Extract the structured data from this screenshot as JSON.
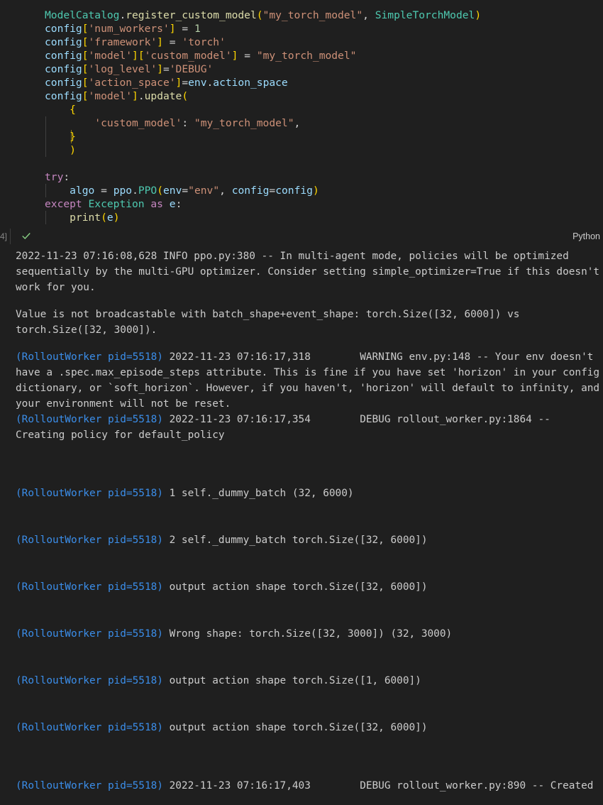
{
  "cell": {
    "execution_count": "4]",
    "language": "Python",
    "status": "success",
    "code_lines": [
      "ModelCatalog.register_custom_model(\"my_torch_model\", SimpleTorchModel)",
      "config['num_workers'] = 1",
      "config['framework'] = 'torch'",
      "config['model']['custom_model'] = \"my_torch_model\"",
      "config['log_level']='DEBUG'",
      "config['action_space']=env.action_space",
      "config['model'].update(",
      "    {",
      "        'custom_model': \"my_torch_model\",",
      "    }",
      "    )",
      "",
      "try:",
      "    algo = ppo.PPO(env=\"env\", config=config)",
      "except Exception as e:",
      "    print(e)"
    ]
  },
  "output": {
    "info_msg": "2022-11-23 07:16:08,628 INFO ppo.py:380 -- In multi-agent mode, policies will be optimized sequentially by the multi-GPU optimizer. Consider setting simple_optimizer=True if this doesn't work for you.",
    "error_msg": "Value is not broadcastable with batch_shape+event_shape: torch.Size([32, 6000]) vs torch.Size([32, 3000]).",
    "warning_prefix": "(RolloutWorker pid=5518)",
    "warning_msg": " 2022-11-23 07:16:17,318\tWARNING env.py:148 -- Your env doesn't have a .spec.max_episode_steps attribute. This is fine if you have set 'horizon' in your config dictionary, or `soft_horizon`. However, if you haven't, 'horizon' will default to infinity, and your environment will not be reset.",
    "debug_prefix": "(RolloutWorker pid=5518)",
    "debug_msg": " 2022-11-23 07:16:17,354\tDEBUG rollout_worker.py:1864 -- Creating policy for default_policy",
    "worker_lines": [
      {
        "prefix": "(RolloutWorker pid=5518)",
        "text": " 1 self._dummy_batch (32, 6000)"
      },
      {
        "prefix": "(RolloutWorker pid=5518)",
        "text": " 2 self._dummy_batch torch.Size([32, 6000])"
      },
      {
        "prefix": "(RolloutWorker pid=5518)",
        "text": " output action shape torch.Size([32, 6000])"
      },
      {
        "prefix": "(RolloutWorker pid=5518)",
        "text": " Wrong shape: torch.Size([32, 3000]) (32, 3000)"
      },
      {
        "prefix": "(RolloutWorker pid=5518)",
        "text": " output action shape torch.Size([1, 6000])"
      },
      {
        "prefix": "(RolloutWorker pid=5518)",
        "text": " output action shape torch.Size([32, 6000])"
      }
    ],
    "last_line_prefix": "(RolloutWorker pid=5518)",
    "last_line_text": " 2022-11-23 07:16:17,403\tDEBUG rollout_worker.py:890 -- Created"
  },
  "colors": {
    "background": "#1f1f1f",
    "pid_prefix": "#3b8eea",
    "success_check": "#89d185"
  }
}
